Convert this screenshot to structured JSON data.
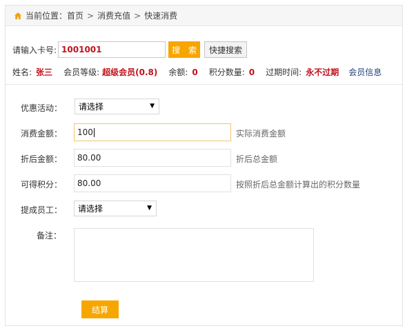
{
  "breadcrumb": {
    "prefix": "当前位置：",
    "items": [
      "首页",
      "消费充值",
      "快速消费"
    ],
    "separator": ">"
  },
  "search": {
    "label": "请输入卡号:",
    "card_value": "1001001",
    "search_button": "搜 索",
    "quick_button": "快捷搜索"
  },
  "member": {
    "name_label": "姓名:",
    "name_value": "张三",
    "level_label": "会员等级:",
    "level_value": "超级会员(0.8)",
    "balance_label": "余额:",
    "balance_value": "0",
    "points_label": "积分数量:",
    "points_value": "0",
    "expire_label": "过期时间:",
    "expire_value": "永不过期",
    "info_link": "会员信息"
  },
  "form": {
    "promo_label": "优惠活动：",
    "promo_selected": "请选择",
    "amount_label": "消费金额：",
    "amount_value": "100",
    "amount_hint": "实际消费金额",
    "discount_label": "折后金额：",
    "discount_value": "80.00",
    "discount_hint": "折后总金额",
    "points_label": "可得积分：",
    "points_value": "80.00",
    "points_hint": "按照折后总金额计算出的积分数量",
    "staff_label": "提成员工：",
    "staff_selected": "请选择",
    "remark_label": "备注：",
    "submit_button": "结算"
  },
  "colors": {
    "accent": "#f7a600",
    "value_red": "#c0121b",
    "link_blue": "#1f3f7a"
  },
  "icons": {
    "breadcrumb": "home-icon",
    "select": "chevron-down-icon"
  }
}
